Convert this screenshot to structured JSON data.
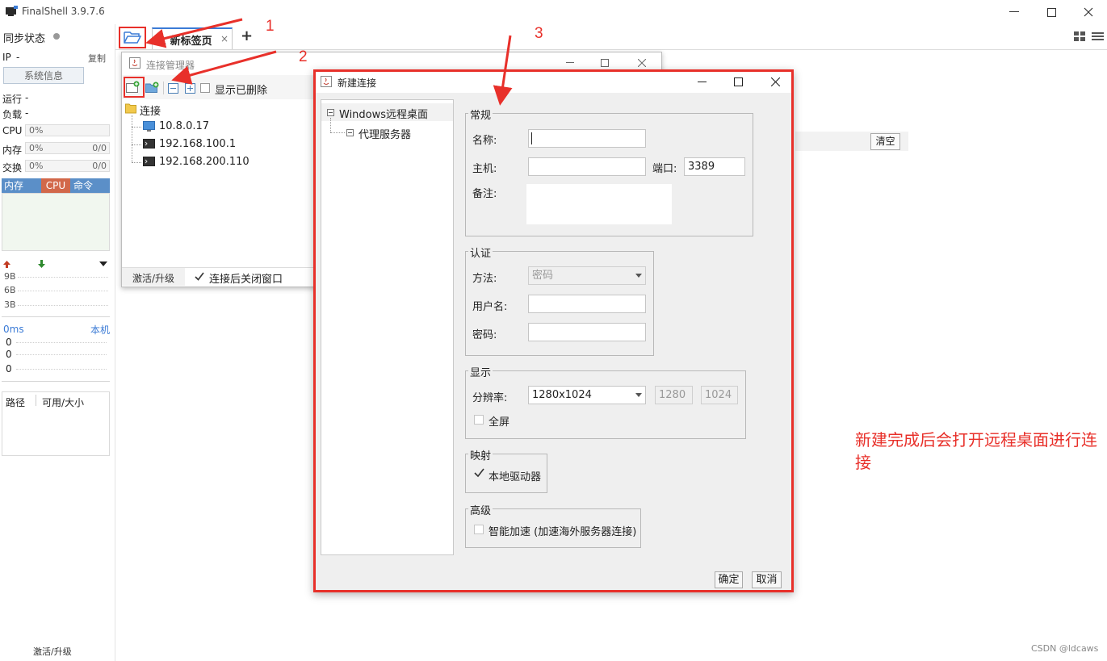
{
  "app": {
    "title": "FinalShell 3.9.7.6"
  },
  "sidebar": {
    "sync_label": "同步状态",
    "ip_label": "IP",
    "ip_value": "-",
    "copy_label": "复制",
    "sysinfo_button": "系统信息",
    "running_label": "运行",
    "running_value": "-",
    "load_label": "负载",
    "load_value": "-",
    "cpu_label": "CPU",
    "cpu_value": "0%",
    "mem_label": "内存",
    "mem_value": "0%",
    "mem_ratio": "0/0",
    "swap_label": "交换",
    "swap_value": "0%",
    "swap_ratio": "0/0",
    "tabs": [
      "内存",
      "CPU",
      "命令"
    ],
    "net_ticks": [
      "9B",
      "6B",
      "3B"
    ],
    "ping_label": "0ms",
    "host_label": "本机",
    "ping_ticks": [
      "0",
      "0",
      "0"
    ],
    "disk_path": "路径",
    "disk_avail": "可用/大小",
    "activate": "激活/升级"
  },
  "tabbar": {
    "tab1_label": "1 新标签页",
    "tab1_close": "×",
    "add_tab": "+"
  },
  "background": {
    "clear_button": "清空"
  },
  "conn_manager": {
    "title": "连接管理器",
    "show_deleted": "显示已删除",
    "root_folder": "连接",
    "items": [
      "10.8.0.17",
      "192.168.100.1",
      "192.168.200.110"
    ],
    "activate": "激活/升级",
    "close_after_connect": "连接后关闭窗口"
  },
  "dialog": {
    "title": "新建连接",
    "tree_root": "Windows远程桌面",
    "tree_child": "代理服务器",
    "general": {
      "title": "常规",
      "name_label": "名称:",
      "name_value": "",
      "host_label": "主机:",
      "host_value": "",
      "port_label": "端口:",
      "port_value": "3389",
      "note_label": "备注:"
    },
    "auth": {
      "title": "认证",
      "method_label": "方法:",
      "method_value": "密码",
      "user_label": "用户名:",
      "password_label": "密码:"
    },
    "display": {
      "title": "显示",
      "resolution_label": "分辨率:",
      "resolution_value": "1280x1024",
      "width_value": "1280",
      "height_value": "1024",
      "fullscreen_label": "全屏",
      "fullscreen_checked": false
    },
    "mapping": {
      "title": "映射",
      "local_drive_label": "本地驱动器",
      "local_drive_checked": true
    },
    "advanced": {
      "title": "高级",
      "accel_label": "智能加速 (加速海外服务器连接)",
      "accel_checked": false
    },
    "ok_button": "确定",
    "cancel_button": "取消"
  },
  "annotations": {
    "step1": "1",
    "step2": "2",
    "step3": "3",
    "note": "新建完成后会打开远程桌面进行连接",
    "color": "#e8302a"
  },
  "watermark": "CSDN @ldcaws"
}
